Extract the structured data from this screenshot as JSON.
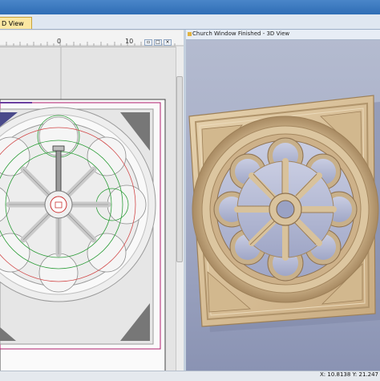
{
  "tab": {
    "label": "D View"
  },
  "ruler": {
    "tick_0": "0",
    "tick_10": "10"
  },
  "view3d": {
    "title": "Church Window Finished - 3D View"
  },
  "status": {
    "coords": "X: 10.8138 Y: 21.247"
  },
  "colors": {
    "accent": "#2f6db5",
    "tab_active": "#fbe7a2",
    "wood": "#d8c09a"
  }
}
